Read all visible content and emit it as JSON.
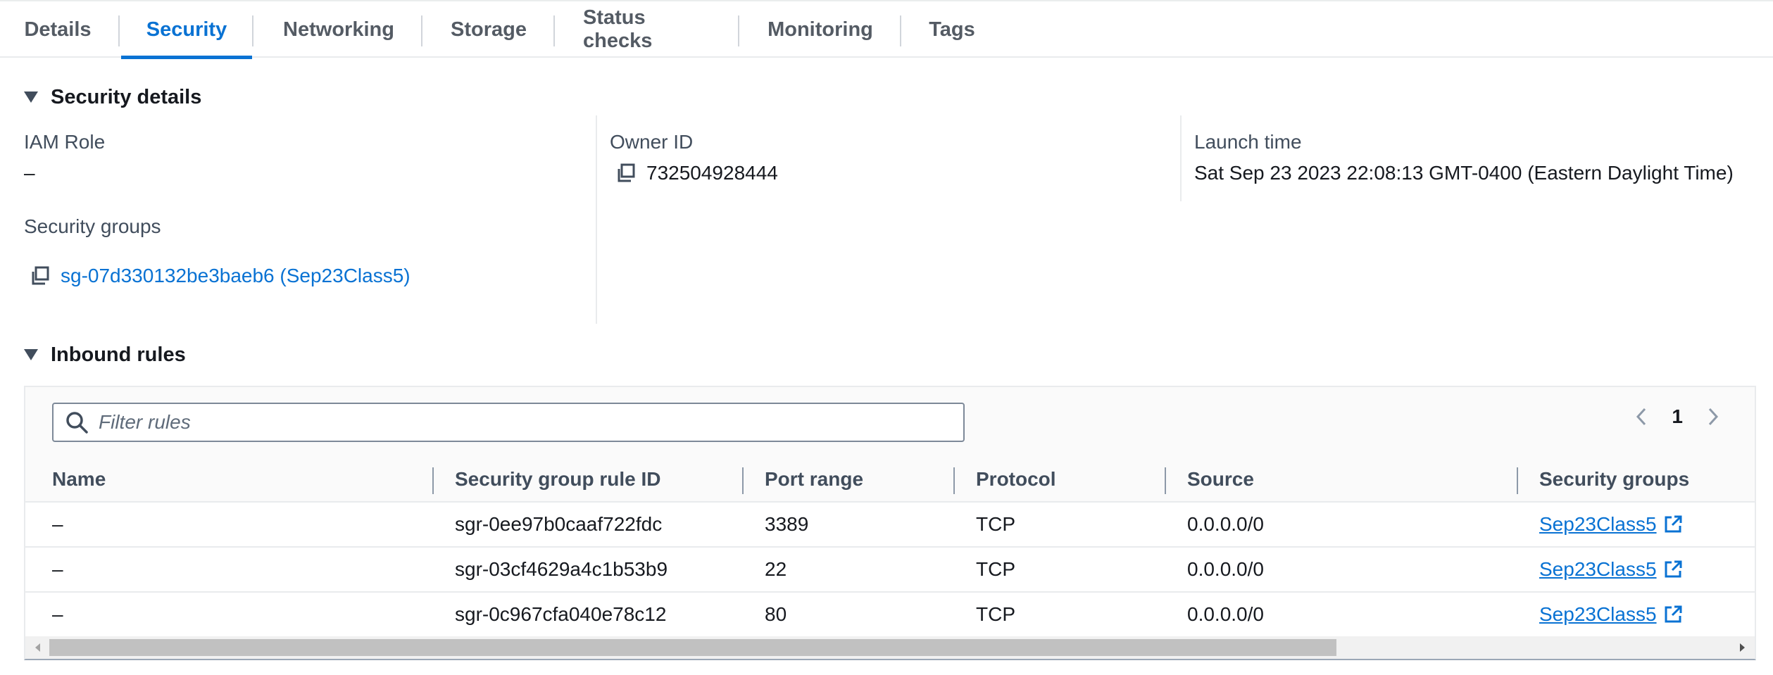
{
  "tabs": [
    {
      "label": "Details"
    },
    {
      "label": "Security"
    },
    {
      "label": "Networking"
    },
    {
      "label": "Storage"
    },
    {
      "label": "Status checks"
    },
    {
      "label": "Monitoring"
    },
    {
      "label": "Tags"
    }
  ],
  "active_tab": "Security",
  "security_details": {
    "title": "Security details",
    "iam_role_label": "IAM Role",
    "iam_role_value": "–",
    "owner_id_label": "Owner ID",
    "owner_id_value": "732504928444",
    "launch_time_label": "Launch time",
    "launch_time_value": "Sat Sep 23 2023 22:08:13 GMT-0400 (Eastern Daylight Time)",
    "security_groups_label": "Security groups",
    "security_group_link": "sg-07d330132be3baeb6 (Sep23Class5)"
  },
  "inbound_rules": {
    "title": "Inbound rules",
    "filter_placeholder": "Filter rules",
    "page": "1",
    "columns": [
      "Name",
      "Security group rule ID",
      "Port range",
      "Protocol",
      "Source",
      "Security groups"
    ],
    "rows": [
      {
        "name": "–",
        "rule_id": "sgr-0ee97b0caaf722fdc",
        "port_range": "3389",
        "protocol": "TCP",
        "source": "0.0.0.0/0",
        "security_group": "Sep23Class5"
      },
      {
        "name": "–",
        "rule_id": "sgr-03cf4629a4c1b53b9",
        "port_range": "22",
        "protocol": "TCP",
        "source": "0.0.0.0/0",
        "security_group": "Sep23Class5"
      },
      {
        "name": "–",
        "rule_id": "sgr-0c967cfa040e78c12",
        "port_range": "80",
        "protocol": "TCP",
        "source": "0.0.0.0/0",
        "security_group": "Sep23Class5"
      }
    ]
  },
  "icons": {
    "copy": "copy-icon",
    "search": "search-icon",
    "external_link": "external-link-icon",
    "pager_prev": "chevron-left-icon",
    "pager_next": "chevron-right-icon"
  },
  "colors": {
    "accent": "#0972d3",
    "text": "#16191f",
    "label": "#414d5c",
    "divider": "#e9ebed"
  }
}
